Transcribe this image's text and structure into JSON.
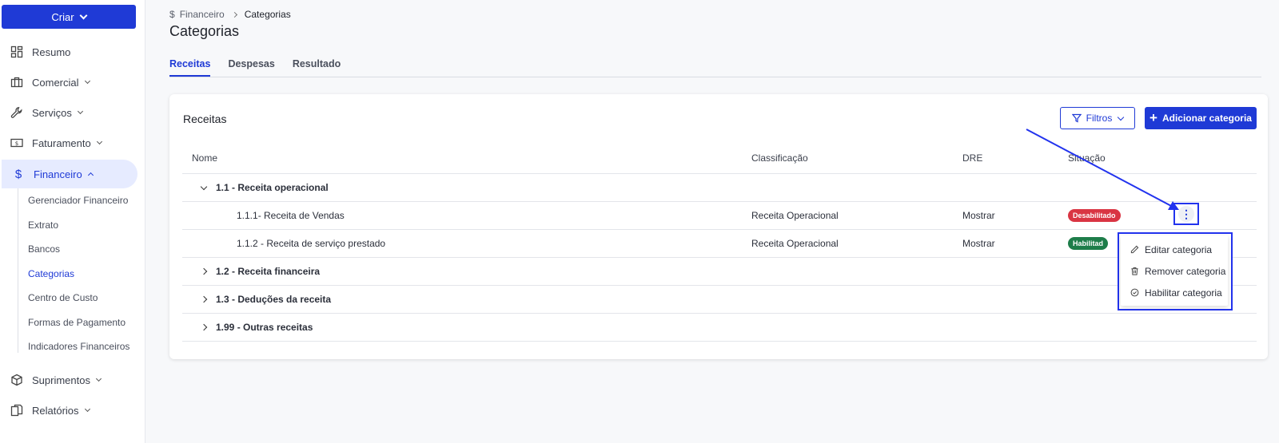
{
  "sidebar": {
    "create_label": "Criar",
    "items": [
      {
        "label": "Resumo",
        "icon": "dashboard-icon"
      },
      {
        "label": "Comercial",
        "icon": "briefcase-icon"
      },
      {
        "label": "Serviços",
        "icon": "wrench-icon"
      },
      {
        "label": "Faturamento",
        "icon": "bill-icon"
      },
      {
        "label": "Financeiro",
        "icon": "dollar-icon"
      },
      {
        "label": "Suprimentos",
        "icon": "box-icon"
      },
      {
        "label": "Relatórios",
        "icon": "documents-icon"
      }
    ],
    "financeiro_sub": [
      "Gerenciador Financeiro",
      "Extrato",
      "Bancos",
      "Categorias",
      "Centro de Custo",
      "Formas de Pagamento",
      "Indicadores Financeiros"
    ]
  },
  "breadcrumb": {
    "section": "Financeiro",
    "current": "Categorias"
  },
  "page": {
    "title": "Categorias"
  },
  "tabs": [
    "Receitas",
    "Despesas",
    "Resultado"
  ],
  "card": {
    "title": "Receitas",
    "filter_label": "Filtros",
    "add_label": "Adicionar categoria"
  },
  "table": {
    "headers": {
      "name": "Nome",
      "classification": "Classificação",
      "dre": "DRE",
      "status": "Situação"
    },
    "groups": [
      {
        "name": "1.1 - Receita operacional"
      },
      {
        "name": "1.2 - Receita financeira"
      },
      {
        "name": "1.3 - Deduções da receita"
      },
      {
        "name": "1.99 - Outras receitas"
      }
    ],
    "rows": [
      {
        "name": "1.1.1- Receita de Vendas",
        "classification": "Receita Operacional",
        "dre": "Mostrar",
        "status": "Desabilitado"
      },
      {
        "name": "1.1.2 - Receita de serviço prestado",
        "classification": "Receita Operacional",
        "dre": "Mostrar",
        "status": "Habilitad"
      }
    ]
  },
  "menu": {
    "edit": "Editar categoria",
    "remove": "Remover categoria",
    "enable": "Habilitar categoria"
  },
  "colors": {
    "accent": "#1f3ad6",
    "disabled_badge": "#d93543",
    "enabled_badge": "#1e7d4a",
    "annotation": "#2233ee"
  }
}
